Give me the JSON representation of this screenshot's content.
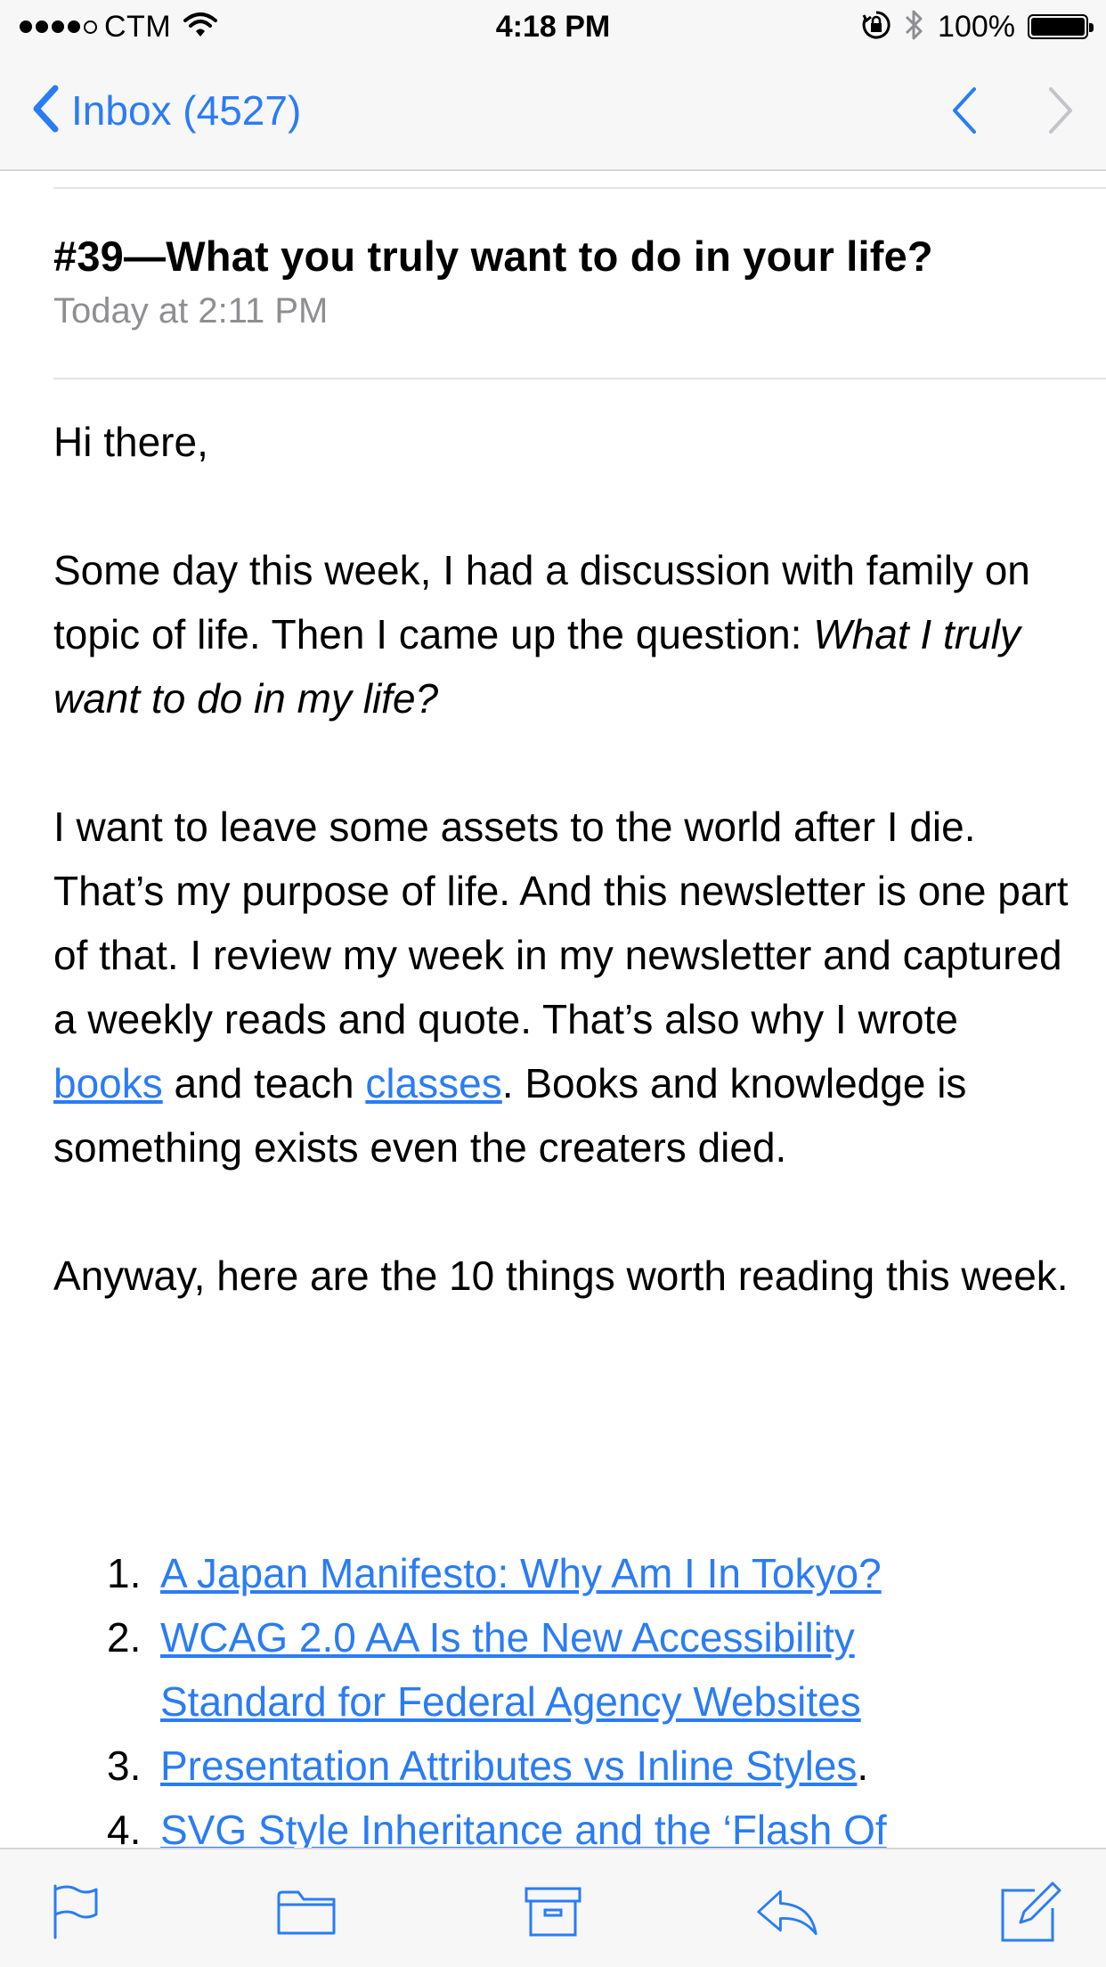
{
  "status_bar": {
    "carrier": "CTM",
    "time": "4:18 PM",
    "battery_percent": "100%",
    "signal_bars_filled": 4,
    "signal_bars_total": 5,
    "icons": [
      "wifi-icon",
      "orientation-lock-icon",
      "bluetooth-icon",
      "battery-icon"
    ]
  },
  "nav": {
    "back_label": "Inbox (4527)",
    "icons": [
      "chevron-left-icon",
      "previous-message-icon",
      "next-message-icon"
    ],
    "accent_color": "#2a7cf6"
  },
  "message": {
    "subject": "#39—What you truly want to do in your life?",
    "date": "Today at 2:11 PM",
    "greeting": "Hi there,",
    "para1_text": "Some day this week, I had a discussion with family on topic of life. Then I came up the question: ",
    "para1_italic": "What I truly want to do in my life?",
    "para2_a": "I want to leave some assets to the world after I die. That’s my purpose of life. And this newsletter is one part of that. I review my week in my newsletter and captured a weekly reads and quote. That’s also why I wrote ",
    "para2_link1": "books",
    "para2_b": " and teach ",
    "para2_link2": "classes",
    "para2_c": ". Books and knowledge is something exists even the creaters died.",
    "para3": "Anyway, here are the 10 things worth reading this week.",
    "reads": [
      {
        "num": "1.",
        "title": "A Japan Manifesto: Why Am I In Tokyo?",
        "suffix": ""
      },
      {
        "num": "2.",
        "title": "WCAG 2.0 AA Is the New Accessibility Standard for Federal Agency Websites",
        "suffix": ""
      },
      {
        "num": "3.",
        "title": "Presentation Attributes vs Inline Styles",
        "suffix": "."
      },
      {
        "num": "4.",
        "title": "SVG Style Inheritance and the ‘Flash Of",
        "suffix": ""
      }
    ]
  },
  "toolbar": {
    "icons": [
      "flag-icon",
      "folder-icon",
      "archive-icon",
      "reply-icon",
      "compose-icon"
    ]
  }
}
